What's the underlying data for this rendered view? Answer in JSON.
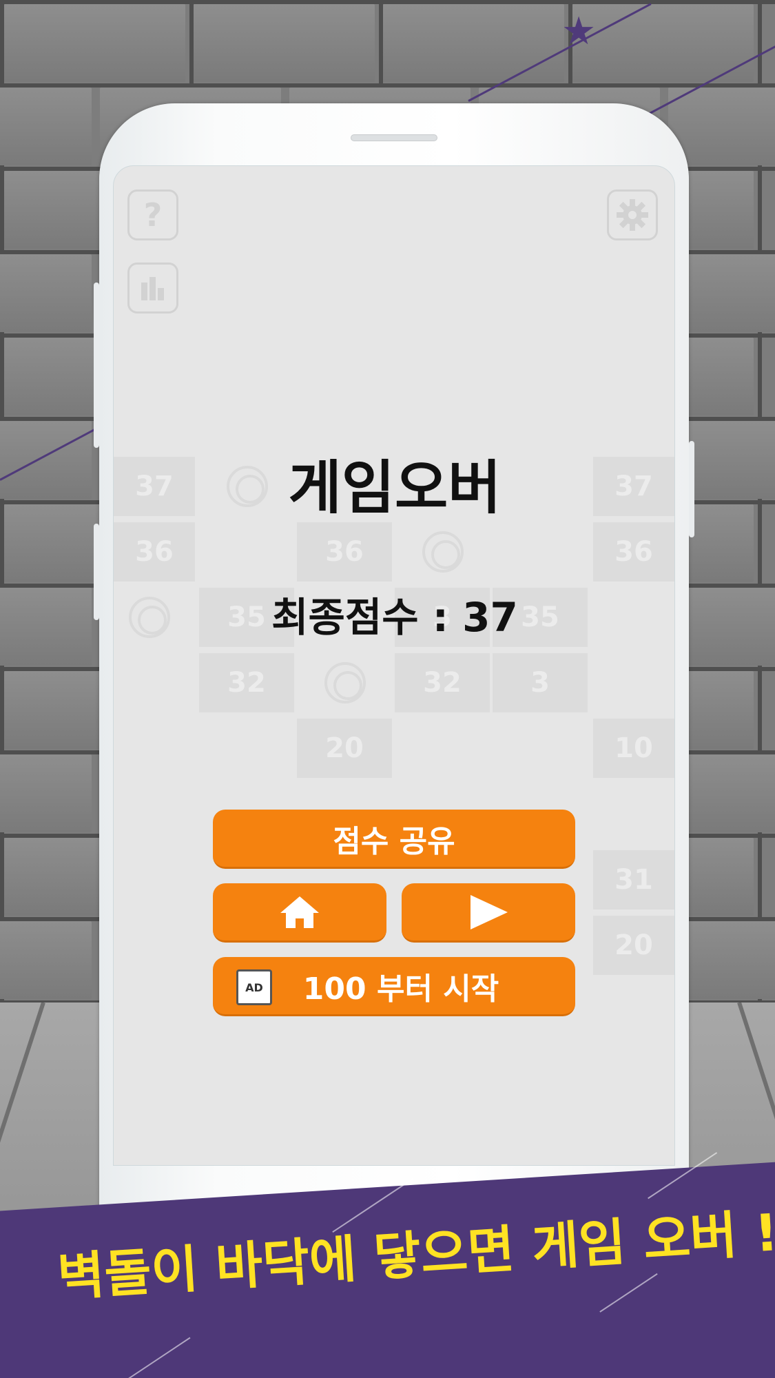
{
  "game": {
    "title": "게임오버",
    "final_score": "최종점수 : 37",
    "share_label": "점수 공유",
    "start_from_label": "100 부터 시작",
    "ad_label": "AD"
  },
  "icons": {
    "help": "?",
    "stats": "bar-chart-icon",
    "settings": "gear-icon",
    "home": "home-icon",
    "play": "play-icon"
  },
  "board": {
    "tiles": [
      "37",
      "37",
      "36",
      "36",
      "36",
      "35",
      "3",
      "35",
      "32",
      "32",
      "3",
      "20",
      "10",
      "31",
      "20"
    ]
  },
  "banner": {
    "text": "벽돌이 바닥에 닿으면 게임 오버 !"
  },
  "colors": {
    "accent": "#f5820f",
    "banner_bg": "#4e3878",
    "banner_text": "#ffe223"
  }
}
